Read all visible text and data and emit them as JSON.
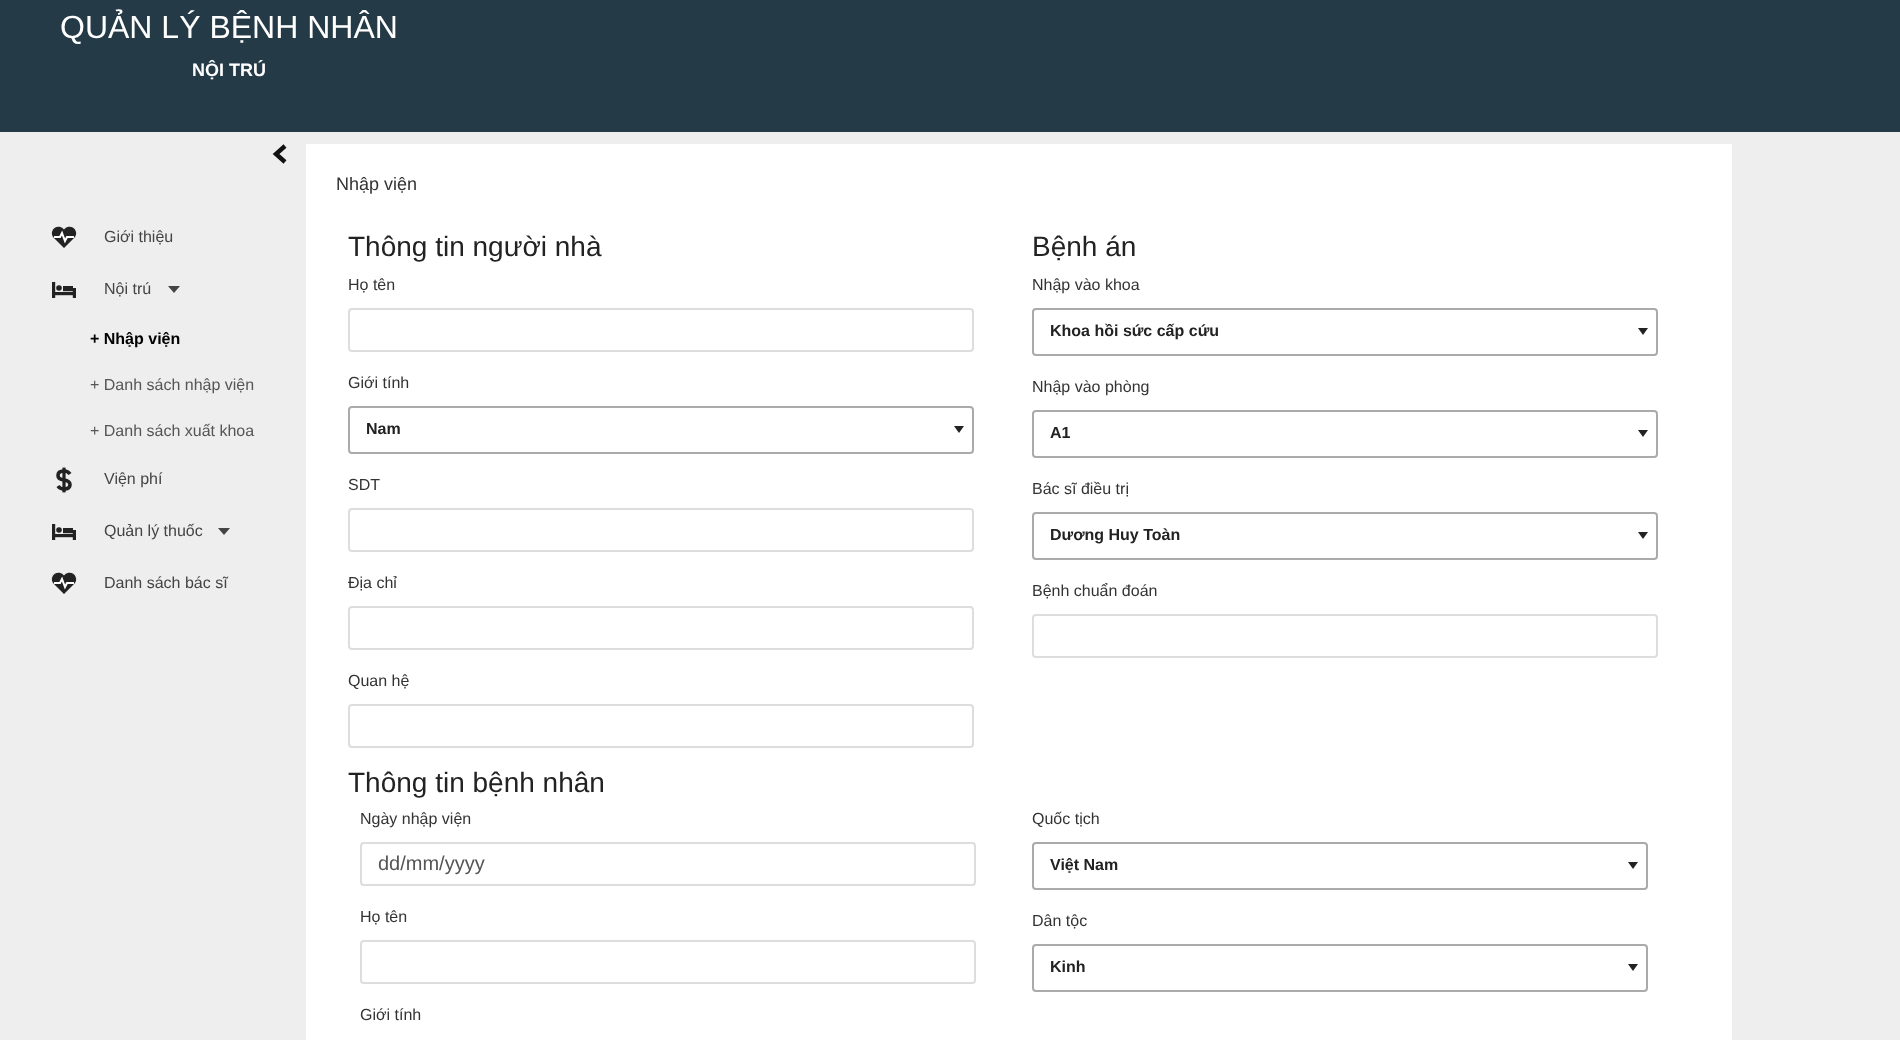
{
  "header": {
    "title": "QUẢN LÝ BỆNH NHÂN",
    "subtitle": "NỘI TRÚ"
  },
  "sidebar": {
    "items": [
      {
        "label": "Giới thiệu",
        "kind": "heart",
        "dropdown": false,
        "selected": false
      },
      {
        "label": "Nội trú",
        "kind": "bed",
        "dropdown": true,
        "selected": false,
        "children": [
          {
            "label": "+ Nhập viện",
            "selected": true
          },
          {
            "label": "+ Danh sách nhập viện",
            "selected": false
          },
          {
            "label": "+ Danh sách xuất khoa",
            "selected": false
          }
        ]
      },
      {
        "label": "Viện phí",
        "kind": "dollar",
        "dropdown": false,
        "selected": false
      },
      {
        "label": "Quản lý thuốc",
        "kind": "bed",
        "dropdown": true,
        "selected": false
      },
      {
        "label": "Danh sách bác sĩ",
        "kind": "heart",
        "dropdown": false,
        "selected": false
      }
    ]
  },
  "breadcrumb": "Nhập viện",
  "top_sections": [
    {
      "heading": "Thông tin người nhà",
      "fields": [
        {
          "label": "Họ tên",
          "kind": "text"
        },
        {
          "label": "Giới tính",
          "kind": "select",
          "value": "Nam"
        },
        {
          "label": "SDT",
          "kind": "text"
        },
        {
          "label": "Địa chỉ",
          "kind": "text"
        },
        {
          "label": "Quan hệ",
          "kind": "text"
        }
      ]
    },
    {
      "heading": "Bệnh án",
      "fields": [
        {
          "label": "Nhập vào khoa",
          "kind": "select",
          "value": "Khoa hồi sức cấp cứu"
        },
        {
          "label": "Nhập vào phòng",
          "kind": "select",
          "value": "A1"
        },
        {
          "label": "Bác sĩ điều trị",
          "kind": "select",
          "value": "Dương Huy Toàn"
        },
        {
          "label": "Bệnh chuẩn đoán",
          "kind": "text"
        }
      ]
    }
  ],
  "patient_section": {
    "heading": "Thông tin bệnh nhân",
    "columns": [
      [
        {
          "label": "Ngày nhập viện",
          "kind": "date",
          "placeholder": "dd/mm/yyyy"
        },
        {
          "label": "Họ tên",
          "kind": "text"
        },
        {
          "label": "Giới tính",
          "kind": "label"
        }
      ],
      [
        {
          "label": "Quốc tịch",
          "kind": "select",
          "value": "Việt Nam"
        },
        {
          "label": "Dân tộc",
          "kind": "select",
          "value": "Kinh"
        }
      ]
    ]
  }
}
